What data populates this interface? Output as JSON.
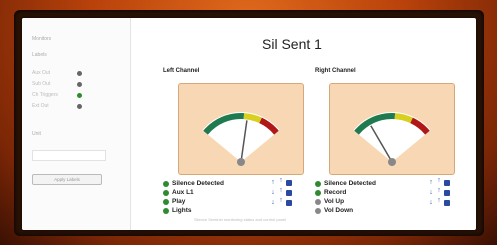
{
  "page": {
    "title": "Sil Sent 1"
  },
  "sidebar": {
    "heading": "Monitors",
    "subheading": "Labels",
    "items": [
      {
        "label": "Aux Out",
        "dot_color": "#666666"
      },
      {
        "label": "Sub Out",
        "dot_color": "#666666"
      },
      {
        "label": "Ch Triggers",
        "dot_color": "#2e8b2e"
      },
      {
        "label": "Ext Out",
        "dot_color": "#666666"
      }
    ],
    "input_label": "Unit",
    "input_value": "",
    "button_label": "Apply Labels"
  },
  "channels": [
    {
      "title": "Left Channel",
      "meter_level": 0.58,
      "statuses": [
        {
          "label": "Silence Detected",
          "color": "#2e8b2e"
        },
        {
          "label": "Aux L1",
          "color": "#2e8b2e"
        },
        {
          "label": "Play",
          "color": "#2e8b2e"
        },
        {
          "label": "Lights",
          "color": "#2e8b2e"
        }
      ]
    },
    {
      "title": "Right Channel",
      "meter_level": 0.2,
      "statuses": [
        {
          "label": "Silence Detected",
          "color": "#2e8b2e"
        },
        {
          "label": "Record",
          "color": "#2e8b2e"
        },
        {
          "label": "Vol Up",
          "color": "#888888"
        },
        {
          "label": "Vol Down",
          "color": "#888888"
        }
      ]
    }
  ],
  "footer": "Silence Sentinel monitoring status and control panel",
  "colors": {
    "frame": "#c4500e",
    "meter_bg": "#f8d8b4",
    "control": "#2a4aa0"
  }
}
